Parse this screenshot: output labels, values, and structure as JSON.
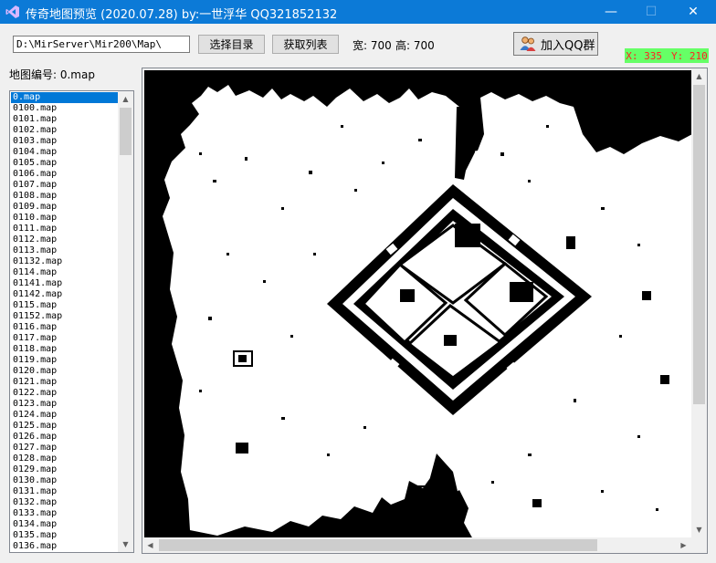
{
  "window": {
    "title": "传奇地图预览 (2020.07.28)   by:一世浮华 QQ321852132",
    "icon": "visual-studio-icon",
    "controls": {
      "minimize": "—",
      "maximize": "☐",
      "close": "✕"
    }
  },
  "toolbar": {
    "path_value": "D:\\MirServer\\Mir200\\Map\\",
    "select_dir_label": "选择目录",
    "get_list_label": "获取列表",
    "width_text": "宽: 700",
    "height_text": "高: 700",
    "join_qq_label": "加入QQ群"
  },
  "coords": {
    "x": "X: 335",
    "y": "Y: 210"
  },
  "map_label": "地图编号: 0.map",
  "map_list": {
    "selected_index": 0,
    "items": [
      "0.map",
      "0100.map",
      "0101.map",
      "0102.map",
      "0103.map",
      "0104.map",
      "0105.map",
      "0106.map",
      "0107.map",
      "0108.map",
      "0109.map",
      "0110.map",
      "0111.map",
      "0112.map",
      "0113.map",
      "01132.map",
      "0114.map",
      "01141.map",
      "01142.map",
      "0115.map",
      "01152.map",
      "0116.map",
      "0117.map",
      "0118.map",
      "0119.map",
      "0120.map",
      "0121.map",
      "0122.map",
      "0123.map",
      "0124.map",
      "0125.map",
      "0126.map",
      "0127.map",
      "0128.map",
      "0129.map",
      "0130.map",
      "0131.map",
      "0132.map",
      "0133.map",
      "0134.map",
      "0135.map",
      "0136.map"
    ]
  },
  "colors": {
    "titlebar": "#0c7ad7",
    "selection": "#0078d7",
    "coord_bg": "#66ff66",
    "coord_text": "#ff2020",
    "map_wall": "#000000",
    "map_floor": "#ffffff"
  }
}
